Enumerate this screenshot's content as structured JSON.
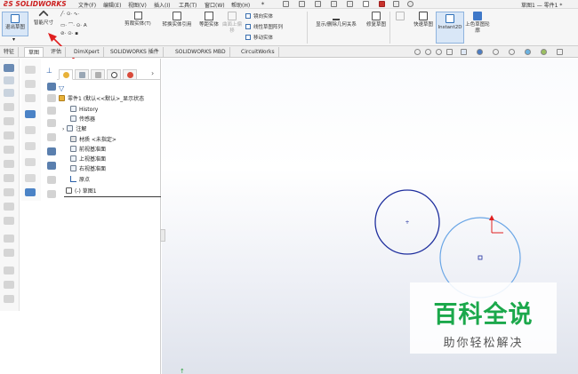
{
  "app": {
    "logo": "SOLIDWORKS",
    "menus": [
      "文件(F)",
      "编辑(E)",
      "视图(V)",
      "插入(I)",
      "工具(T)",
      "窗口(W)",
      "帮助(H)"
    ],
    "doc_title": "草图1 — 零件1 *"
  },
  "commands": {
    "exit_sketch": "退出草图",
    "smart_dim": "智能尺寸",
    "trim": "剪裁实体(T)",
    "convert": "转换实体引用",
    "offset": "等距实体",
    "surface_offset": "曲面上偏移",
    "mirror": "镜向实体",
    "linear_pattern": "线性草图阵列",
    "move": "移动实体",
    "show_relations": "显示/删除几何关系",
    "repair": "修复草图",
    "quick_snaps": "快速草图",
    "instant2d": "Instant2D",
    "shaded_contour": "上色草图轮廓"
  },
  "tabs": [
    "特征",
    "草图",
    "评估",
    "DimXpert",
    "SOLIDWORKS 插件",
    "SOLIDWORKS MBD",
    "CircuitWorks"
  ],
  "tree": {
    "root": "零件1 (默认<<默认>_显示状态",
    "items": [
      "History",
      "传感器",
      "注解",
      "材质 <未指定>",
      "前视基准面",
      "上视基准面",
      "右视基准面",
      "原点",
      "(-) 草图1"
    ]
  },
  "watermark": {
    "main": "百科全说",
    "sub": "助你轻松解决"
  },
  "colors": {
    "circle_left": "#1f2f9e",
    "circle_right": "#6aa6e6",
    "annotation_arrow": "#e02020",
    "watermark_green": "#1ba84b",
    "solidworks_red": "#cc1f1f"
  }
}
